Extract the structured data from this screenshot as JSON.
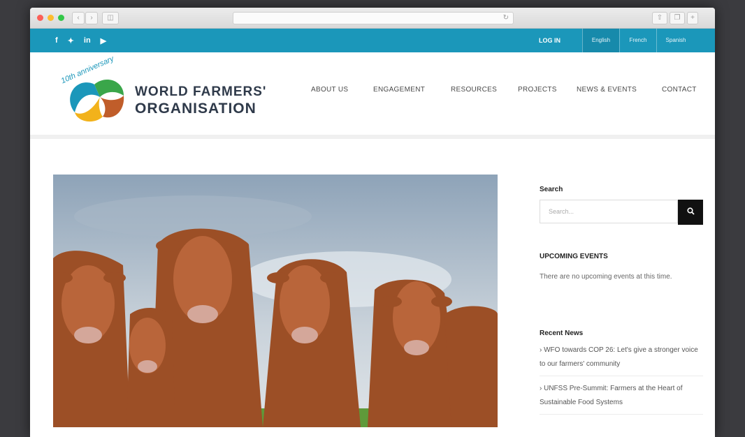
{
  "social": {
    "facebook": "f",
    "twitter": "✦",
    "linkedin": "in",
    "youtube": "▶"
  },
  "topbar": {
    "login": "LOG IN",
    "languages": [
      "English",
      "French",
      "Spanish"
    ]
  },
  "brand": {
    "anniversary": "10th anniversary",
    "line1": "WORLD FARMERS'",
    "line2": "ORGANISATION"
  },
  "nav": [
    "ABOUT US",
    "ENGAGEMENT",
    "RESOURCES",
    "PROJECTS",
    "NEWS & EVENTS",
    "CONTACT"
  ],
  "sidebar": {
    "search_title": "Search",
    "search_placeholder": "Search...",
    "events_title": "UPCOMING EVENTS",
    "events_text": "There are no upcoming events at this time.",
    "news_title": "Recent News",
    "news": [
      "WFO towards COP 26: Let's give a stronger voice to our farmers' community",
      "UNFSS Pre-Summit: Farmers at the Heart of Sustainable Food Systems"
    ]
  },
  "colors": {
    "topbar": "#1b97ba",
    "brand_text": "#2f3a4a"
  }
}
